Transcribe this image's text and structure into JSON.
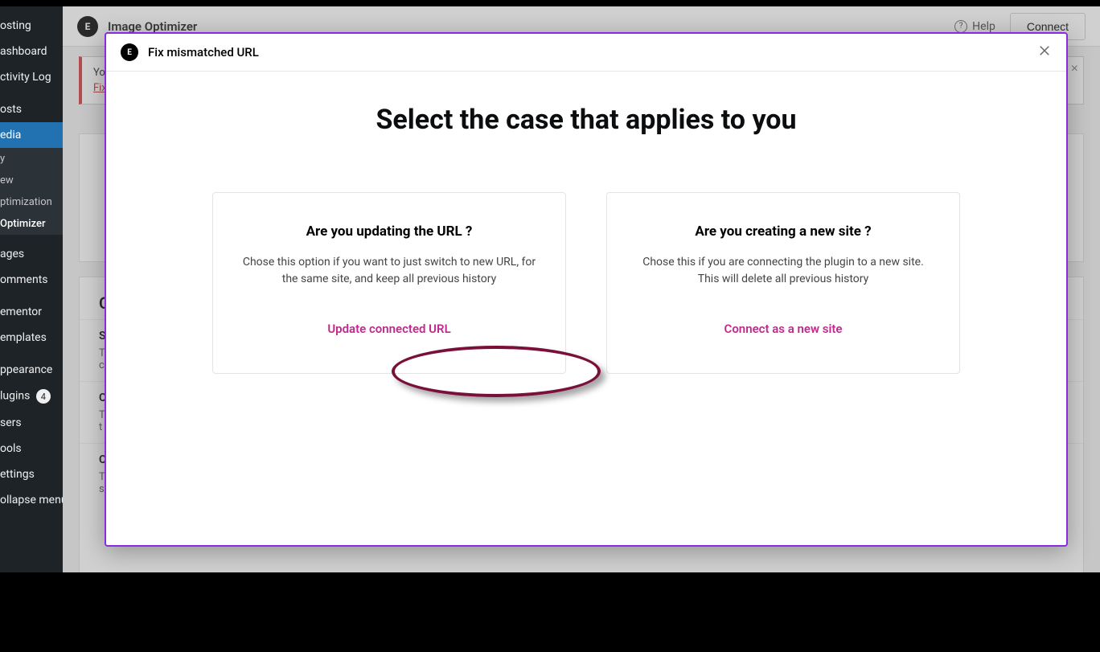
{
  "sidebar": {
    "items": [
      {
        "label": "osting"
      },
      {
        "label": "ashboard"
      },
      {
        "label": "ctivity Log"
      },
      {
        "label": "osts"
      },
      {
        "label": "edia"
      },
      {
        "label": "y"
      },
      {
        "label": "ew"
      },
      {
        "label": "ptimization"
      },
      {
        "label": " Optimizer"
      },
      {
        "label": "ages"
      },
      {
        "label": "omments"
      },
      {
        "label": "ementor"
      },
      {
        "label": "emplates"
      },
      {
        "label": "ppearance"
      },
      {
        "label": "lugins"
      },
      {
        "label": "sers"
      },
      {
        "label": "ools"
      },
      {
        "label": "ettings"
      },
      {
        "label": "ollapse menu"
      }
    ],
    "plugins_badge": "4"
  },
  "header": {
    "title": "Image Optimizer",
    "help_label": "Help",
    "connect_label": "Connect"
  },
  "notice": {
    "line1_prefix": "Yo",
    "fix_link": "Fix",
    "close": "×"
  },
  "background": {
    "section_title": "C",
    "rows": [
      {
        "title": "S",
        "desc1": "T",
        "desc2": "c"
      },
      {
        "title": "C",
        "desc1": "T",
        "desc2": "t"
      },
      {
        "title": "C",
        "desc1": "T",
        "desc2": "settings to all new uploads."
      }
    ]
  },
  "modal": {
    "title": "Fix mismatched URL",
    "heading": "Select the case that applies to you",
    "cards": [
      {
        "title": "Are you updating the URL ?",
        "desc": "Chose this option if you want to just switch to new URL, for the same site, and keep all previous history",
        "action": "Update connected URL"
      },
      {
        "title": "Are you creating a new site ?",
        "desc": "Chose this if you are connecting the plugin to a  new site. This will delete all previous history",
        "action": "Connect as a new site"
      }
    ]
  }
}
